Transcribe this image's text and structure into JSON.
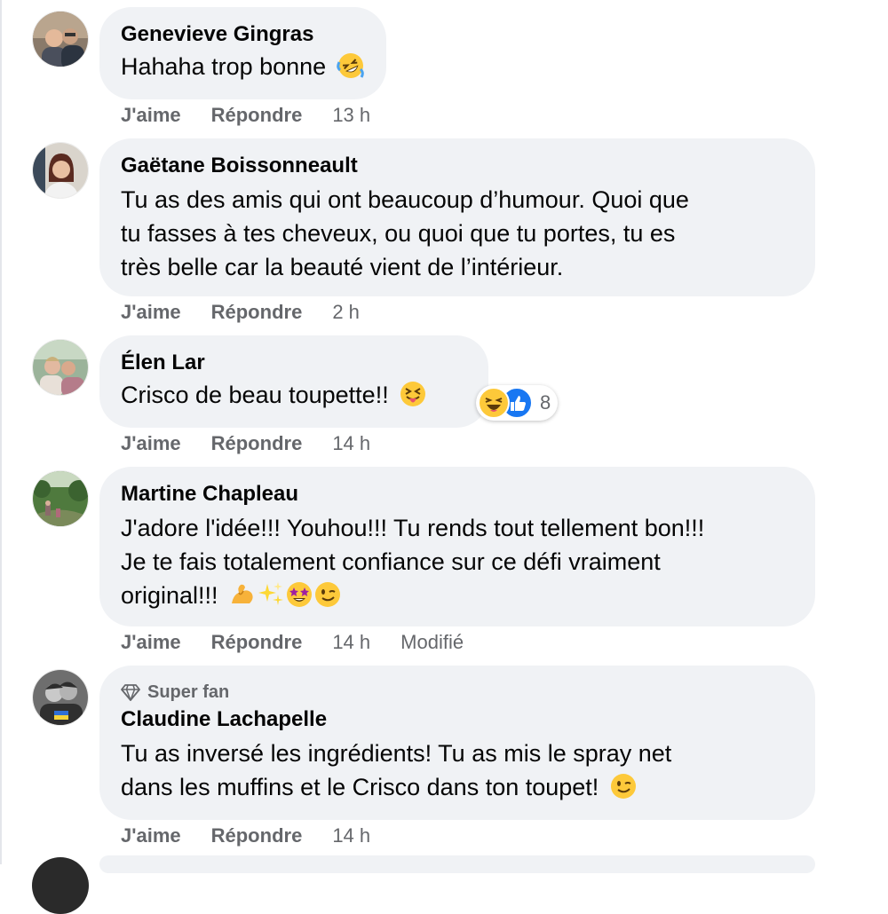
{
  "action_labels": {
    "like": "J'aime",
    "reply": "Répondre"
  },
  "comments": [
    {
      "author": "Genevieve Gingras",
      "text": "Hahaha trop bonne",
      "emoji": [
        "rolling-laughing"
      ],
      "time": "13 h"
    },
    {
      "author": "Gaëtane Boissonneault",
      "lines": [
        "Tu as des amis qui ont beaucoup d’humour. Quoi que",
        "tu fasses à tes cheveux, ou quoi que tu portes, tu es",
        "très belle car la beauté vient de l’intérieur."
      ],
      "time": "2 h"
    },
    {
      "author": "Élen Lar",
      "text": "Crisco de beau toupette!!",
      "emoji": [
        "squinting-tongue"
      ],
      "time": "14 h",
      "reactions": {
        "icons": [
          "haha-reaction-icon",
          "like-reaction-icon"
        ],
        "count": "8"
      }
    },
    {
      "author": "Martine Chapleau",
      "lines": [
        "J'adore l'idée!!! Youhou!!! Tu rends tout tellement bon!!!",
        "Je te fais totalement confiance sur ce défi vraiment",
        "original!!!"
      ],
      "emoji": [
        "flexed-biceps",
        "sparkles",
        "star-struck",
        "winking"
      ],
      "time": "14 h",
      "edited": "Modifié"
    },
    {
      "author": "Claudine Lachapelle",
      "badge": "Super fan",
      "badge_icon": "diamond-icon",
      "lines": [
        "Tu as inversé les ingrédients! Tu as mis le spray net",
        "dans les muffins et le Crisco dans ton toupet!"
      ],
      "emoji": [
        "winking"
      ],
      "time": "14 h"
    }
  ],
  "colors": {
    "bubble": "#f0f2f5",
    "meta": "#65676b",
    "text": "#050505",
    "like_blue": "#1877f2",
    "emoji_yellow": "#fdc93a"
  }
}
